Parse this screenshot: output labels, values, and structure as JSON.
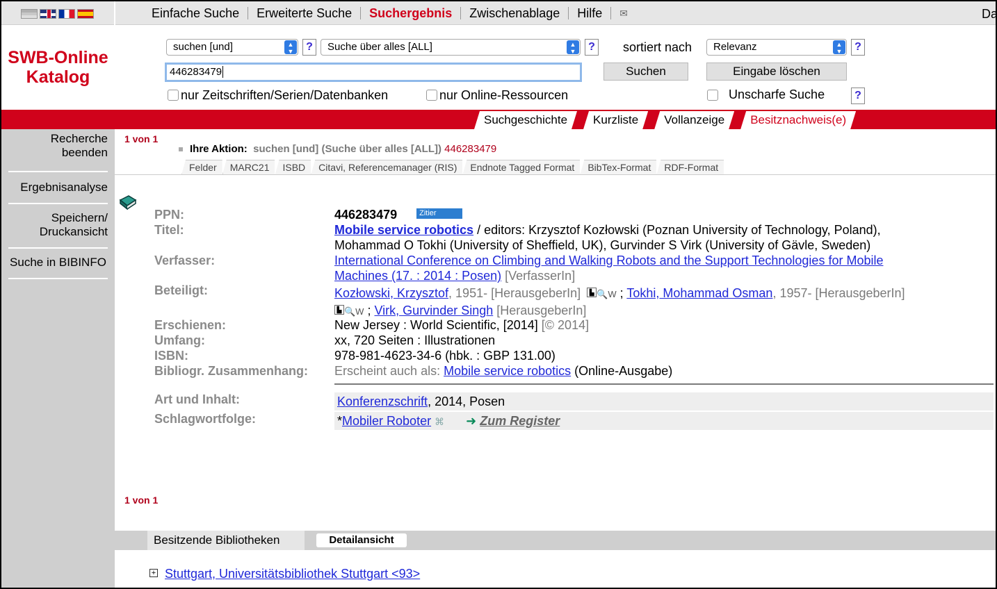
{
  "topnav": {
    "items": [
      "Einfache Suche",
      "Erweiterte Suche",
      "Suchergebnis",
      "Zwischenablage",
      "Hilfe"
    ],
    "active": "Suchergebnis",
    "mail_icon": "envelope-icon",
    "right_cut": "Da"
  },
  "logo": {
    "line1": "SWB-Online",
    "line2": "Katalog"
  },
  "sidebar": {
    "items": [
      {
        "line1": "Recherche",
        "line2": "beenden"
      },
      {
        "line1": "Ergebnisanalyse",
        "line2": ""
      },
      {
        "line1": "Speichern/",
        "line2": "Druckansicht"
      },
      {
        "line1": "Suche in BIBINFO",
        "line2": ""
      }
    ]
  },
  "search": {
    "op_select": "suchen [und]",
    "field_select": "Suche über alles [ALL]",
    "sort_label": "sortiert nach",
    "sort_select": "Relevanz",
    "query": "446283479",
    "search_button": "Suchen",
    "clear_button": "Eingabe löschen",
    "cb_journals": "nur Zeitschriften/Serien/Datenbanken",
    "cb_online": "nur Online-Ressourcen",
    "cb_fuzzy": "Unscharfe Suche",
    "help": "?"
  },
  "tabs": [
    "Suchgeschichte",
    "Kurzliste",
    "Vollanzeige",
    "Besitznachweis(e)"
  ],
  "active_tab": "Besitznachweis(e)",
  "result": {
    "count": "1 von 1",
    "action_label": "Ihre Aktion:",
    "action_text": "suchen [und] (Suche über alles [ALL])",
    "action_ppn": "446283479",
    "formats": [
      "Felder",
      "MARC21",
      "ISBD",
      "Citavi, Referencemanager (RIS)",
      "Endnote Tagged Format",
      "BibTex-Format",
      "RDF-Format"
    ],
    "zitier": "Zitier",
    "record": {
      "ppn_label": "PPN:",
      "ppn": "446283479",
      "titel_label": "Titel:",
      "titel_link": "Mobile service robotics",
      "titel_rest1": " / editors: Krzysztof Kozłowski (Poznan University of Technology, Poland),",
      "titel_rest2": "Mohammad O Tokhi (University of Sheffield, UK), Gurvinder S Virk (University of Gävle, Sweden)",
      "verfasser_label": "Verfasser:",
      "verfasser_link1": "International Conference on Climbing and Walking Robots and the Support Technologies for Mobile",
      "verfasser_link2": "Machines (17. : 2014 : Posen)",
      "verfasser_role": " [VerfasserIn]",
      "beteiligt_label": "Beteiligt:",
      "person1": "Kozłowski, Krzysztof",
      "person1_rest": ", 1951- [HerausgeberIn]",
      "person2": "Tokhi, Mohammad Osman",
      "person2_rest": ", 1957- [HerausgeberIn]",
      "person3": "Virk, Gurvinder Singh",
      "person3_rest": " [HerausgeberIn]",
      "semicolon": " ; ",
      "erschienen_label": "Erschienen:",
      "erschienen": "New Jersey : World Scientific, [2014]",
      "erschienen_copy": " [© 2014]",
      "umfang_label": "Umfang:",
      "umfang": "xx, 720 Seiten : Illustrationen",
      "isbn_label": "ISBN:",
      "isbn": "978-981-4623-34-6 (hbk. : GBP 131.00)",
      "zusammenhang_label": "Bibliogr. Zusammenhang:",
      "zusammenhang_pre": "Erscheint auch als: ",
      "zusammenhang_link": "Mobile service robotics",
      "zusammenhang_post": " (Online-Ausgabe)",
      "art_label": "Art und Inhalt:",
      "art_link": "Konferenzschrift",
      "art_rest": ", 2014, Posen",
      "schlag_label": "Schlagwortfolge:",
      "schlag_star": "*",
      "schlag_link": "Mobiler Roboter",
      "register": "Zum Register"
    },
    "holdings_tab": "Besitzende Bibliotheken",
    "detail_button": "Detailansicht",
    "library": "Stuttgart, Universitätsbibliothek Stuttgart <93>"
  }
}
